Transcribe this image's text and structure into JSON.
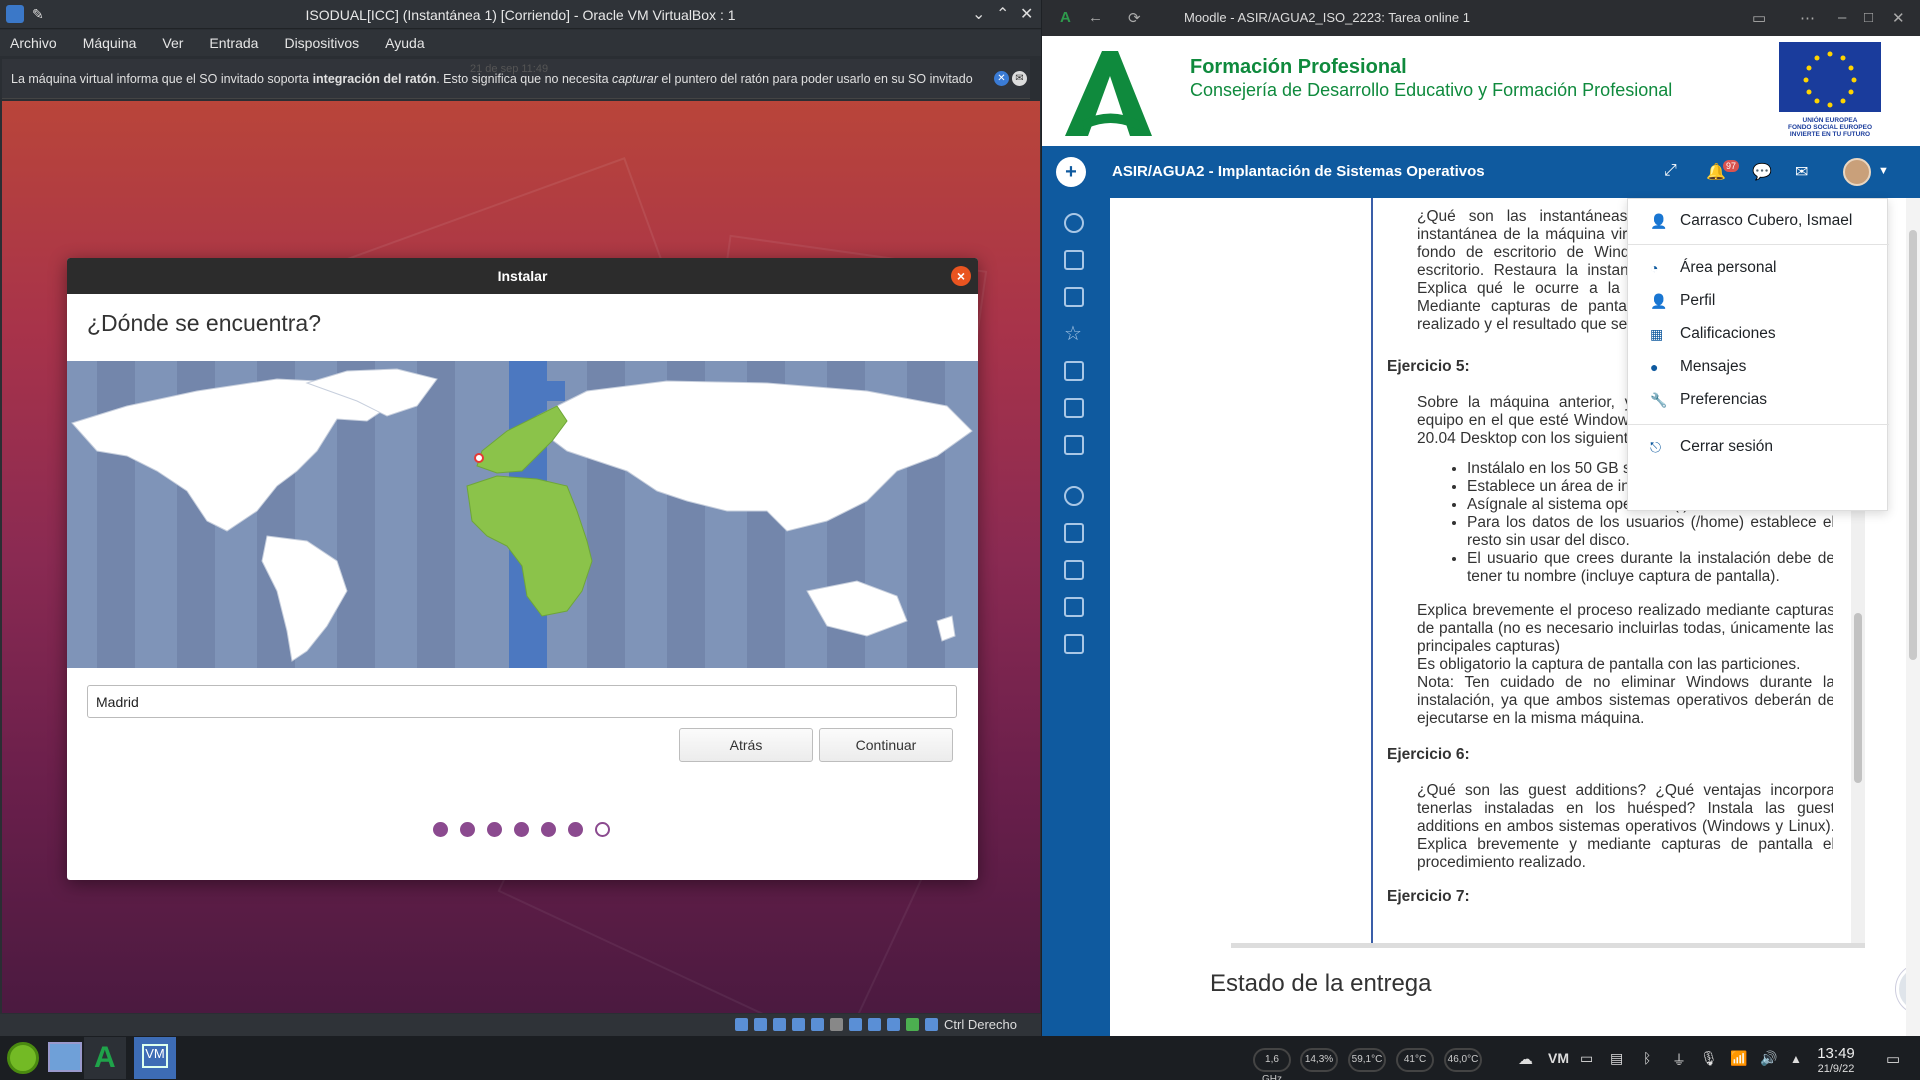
{
  "vbox": {
    "title": "ISODUAL[ICC] (Instantánea 1) [Corriendo] - Oracle VM VirtualBox : 1",
    "menu": [
      "Archivo",
      "Máquina",
      "Ver",
      "Entrada",
      "Dispositivos",
      "Ayuda"
    ],
    "notice_pre": "La máquina virtual informa que el SO invitado soporta ",
    "notice_bold": "integración del ratón",
    "notice_mid": ". Esto significa que no necesita ",
    "notice_ital": "capturar",
    "notice_post": " el puntero del ratón para poder usarlo en su SO invitado",
    "ghost_clock": "21 de sep  11:49",
    "host_key": "Ctrl Derecho"
  },
  "installer": {
    "title": "Instalar",
    "question": "¿Dónde se encuentra?",
    "city_value": "Madrid",
    "back_label": "Atrás",
    "continue_label": "Continuar",
    "steps_total": 7,
    "steps_done": 6
  },
  "browser": {
    "tab_title": "Moodle - ASIR/AGUA2_ISO_2223: Tarea online 1",
    "fp_title": "Formación Profesional",
    "fp_subtitle": "Consejería de Desarrollo Educativo y Formación Profesional",
    "eu_text1": "UNIÓN EUROPEA",
    "eu_text2": "FONDO SOCIAL EUROPEO",
    "eu_text3": "INVIERTE EN TU FUTURO",
    "course": "ASIR/AGUA2 - Implantación de Sistemas Operativos",
    "notif_count": "97",
    "estado": "Estado de la entrega"
  },
  "user_menu": {
    "name": "Carrasco Cubero, Ismael",
    "items": [
      "Área personal",
      "Perfil",
      "Calificaciones",
      "Mensajes",
      "Preferencias"
    ],
    "logout": "Cerrar sesión"
  },
  "task": {
    "p1": "¿Qué son las instantáneas en VirtualBox? Crea una instantánea de la máquina virtual con Windows. Cambia el fondo de escritorio de Windows y crea carpetas en el escritorio. Restaura la instantánea creada en VirtualBox. Explica qué le ocurre a la máquina en este momento. Mediante capturas de pantalla, explica el procedimiento realizado y el resultado que se obtiene.",
    "ej5": "Ejercicio 5:",
    "p5": "Sobre la máquina anterior, y con el mismo disco duro, equipo en el que esté Windows ya instalado, instala Ubuntu 20.04 Desktop con los siguientes requisitos:",
    "li": [
      "Instálalo en los 50 GB sin usar del disco anterior.",
      "Establece un área de intercambio (SWAP) de 3GB.",
      "Asígnale al sistema operativo (/) 30GB.",
      "Para los datos de los usuarios (/home) establece el resto sin usar del disco.",
      "El usuario que crees durante la instalación debe de tener tu nombre (incluye captura de pantalla)."
    ],
    "p5b": "Explica brevemente el proceso realizado mediante capturas de pantalla (no es necesario incluirlas todas, únicamente las principales capturas)",
    "p5c": "Es obligatorio la captura de pantalla con las particiones.",
    "p5d": "Nota: Ten cuidado de no eliminar Windows durante la instalación, ya que ambos sistemas operativos deberán de ejecutarse en la misma máquina.",
    "ej6": "Ejercicio 6:",
    "p6": "¿Qué son las guest additions?  ¿Qué ventajas incorpora tenerlas instaladas en los huésped?  Instala las guest additions en ambos sistemas operativos (Windows y Linux). Explica brevemente y mediante capturas de pantalla el procedimiento realizado.",
    "ej7": "Ejercicio 7:"
  },
  "taskbar": {
    "cpu_freq": "1,6 GHz",
    "cpu_load": "14,3%",
    "temp1": "59,1°C",
    "temp2": "41°C",
    "temp3": "46,0°C",
    "time": "13:49",
    "date": "21/9/22"
  }
}
